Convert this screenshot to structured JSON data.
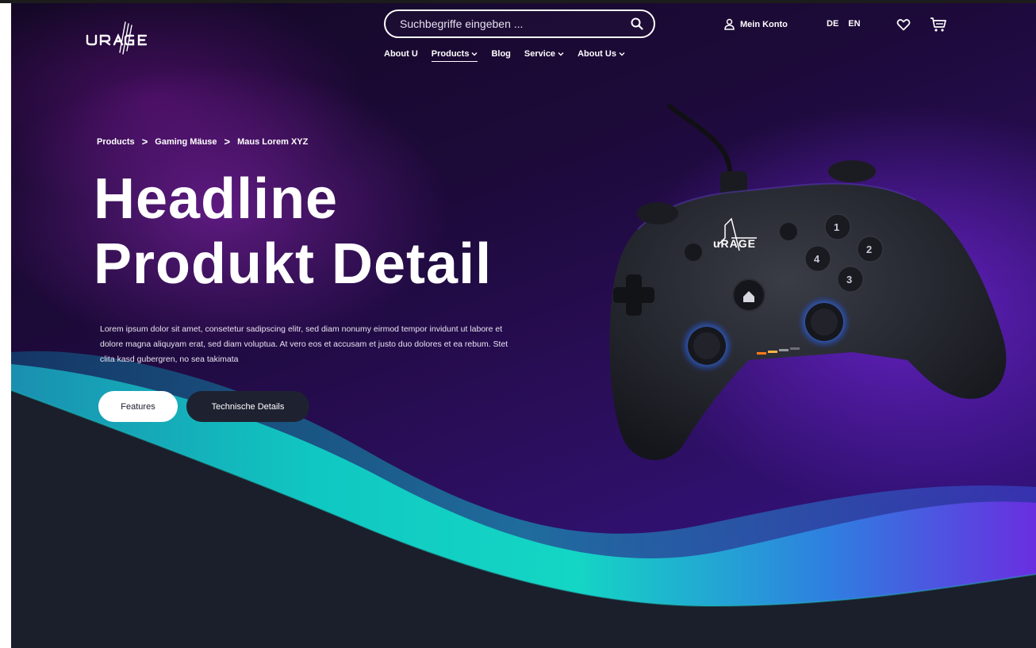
{
  "header": {
    "logo_text": "uRAGE",
    "search": {
      "placeholder": "Suchbegriffe eingeben ..."
    },
    "nav": [
      {
        "label": "About U"
      },
      {
        "label": "Products",
        "has_dropdown": true,
        "active": true
      },
      {
        "label": "Blog"
      },
      {
        "label": "Service",
        "has_dropdown": true
      },
      {
        "label": "About Us",
        "has_dropdown": true
      }
    ],
    "account_label": "Mein Konto",
    "languages": [
      "DE",
      "EN"
    ]
  },
  "breadcrumb": [
    "Products",
    "Gaming Mäuse",
    "Maus Lorem XYZ"
  ],
  "hero": {
    "headline_line1": "Headline",
    "headline_line2": "Produkt Detail",
    "description": "Lorem ipsum dolor sit amet, consetetur sadipscing elitr, sed diam nonumy eirmod tempor invidunt ut labore et dolore magna aliquyam erat, sed diam voluptua. At vero eos et accusam et justo duo dolores et ea rebum. Stet clita kasd gubergren, no sea takimata",
    "buttons": {
      "features": "Features",
      "tech_details": "Technische Details"
    }
  },
  "colors": {
    "accent_teal": "#12d1c0",
    "purple": "#5a1fd0",
    "dark": "#1e2230",
    "white": "#ffffff"
  },
  "icons": [
    "search-icon",
    "user-icon",
    "heart-icon",
    "cart-icon",
    "chevron-down-icon"
  ]
}
